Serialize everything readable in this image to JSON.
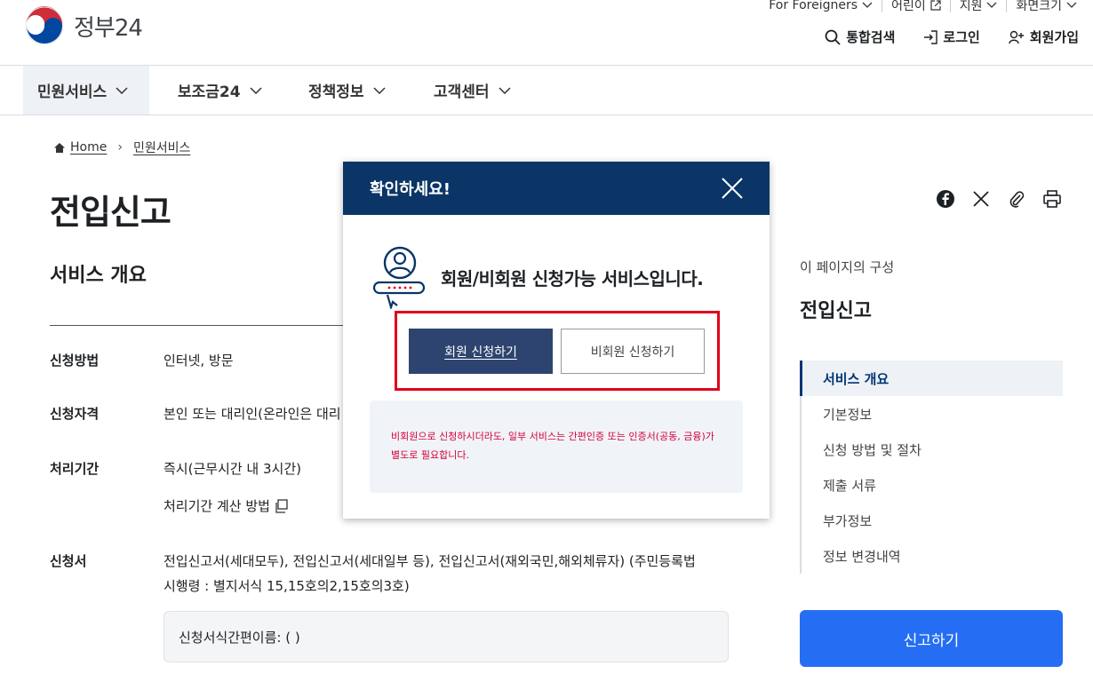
{
  "header": {
    "logo_text": "정부24",
    "util": [
      {
        "label": "For Foreigners",
        "icon": "chevron-down-icon"
      },
      {
        "label": "어린이",
        "icon": "external-link-icon"
      },
      {
        "label": "지원",
        "icon": "chevron-down-icon"
      },
      {
        "label": "화면크기",
        "icon": "chevron-down-icon"
      }
    ],
    "actions": {
      "search": "통합검색",
      "login": "로그인",
      "signup": "회원가입"
    }
  },
  "nav": [
    {
      "label": "민원서비스"
    },
    {
      "label": "보조금24"
    },
    {
      "label": "정책정보"
    },
    {
      "label": "고객센터"
    }
  ],
  "breadcrumb": {
    "home": "Home",
    "current": "민원서비스"
  },
  "page": {
    "title": "전입신고",
    "section_title": "서비스 개요",
    "rows": {
      "method_label": "신청방법",
      "method_value": "인터넷, 방문",
      "qual_label": "신청자격",
      "qual_value": "본인 또는 대리인(온라인은 대리",
      "period_label": "처리기간",
      "period_value": "즉시(근무시간 내 3시간)",
      "period_link": "처리기간 계산 방법",
      "form_label": "신청서",
      "form_value_1": "전입신고서(세대모두), 전입신고서(세대일부 등), 전입신고서(재외국민,해외체류자) (주민등록법",
      "form_value_2": "시행령 : 별지서식 15,15호의2,15호의3호)"
    },
    "form_box": "신청서식간편이름: ( )"
  },
  "sidebar": {
    "caption": "이 페이지의 구성",
    "title": "전입신고",
    "items": [
      {
        "label": "서비스 개요"
      },
      {
        "label": "기본정보"
      },
      {
        "label": "신청 방법 및 절차"
      },
      {
        "label": "제출 서류"
      },
      {
        "label": "부가정보"
      },
      {
        "label": "정보 변경내역"
      }
    ],
    "report_button": "신고하기"
  },
  "modal": {
    "title": "확인하세요!",
    "message": "회원/비회원 신청가능 서비스입니다.",
    "member_button": "회원 신청하기",
    "guest_button": "비회원 신청하기",
    "notice_1": "비회원으로 신청하시더라도, 일부 서비스는 간편인증 또는 인증서(공동, 금융)가",
    "notice_2": "별도로 필요합니다."
  },
  "colors": {
    "modal_header": "#0a3566",
    "member_button": "#2e4470",
    "highlight": "#e0001b",
    "notice_text": "#d6003a",
    "report_button": "#256ef4"
  }
}
